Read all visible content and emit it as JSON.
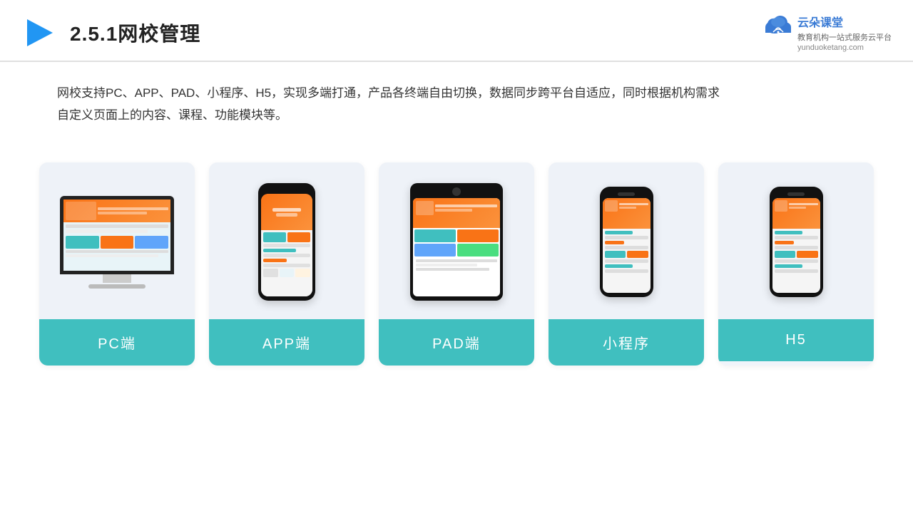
{
  "header": {
    "section_number": "2.5.1",
    "title": "网校管理",
    "brand_name": "云朵课堂",
    "brand_url": "yunduoketang.com",
    "brand_tagline": "教育机构一站式服务云平台"
  },
  "description": {
    "text": "网校支持PC、APP、PAD、小程序、H5，实现多端打通，产品各终端自由切换，数据同步跨平台自适应，同时根据机构需求自定义页面上的内容、课程、功能模块等。"
  },
  "cards": [
    {
      "id": "pc",
      "label": "PC端"
    },
    {
      "id": "app",
      "label": "APP端"
    },
    {
      "id": "pad",
      "label": "PAD端"
    },
    {
      "id": "miniprogram",
      "label": "小程序"
    },
    {
      "id": "h5",
      "label": "H5"
    }
  ],
  "colors": {
    "teal": "#40bfbf",
    "accent_blue": "#3a7bd5",
    "arrow_blue": "#2196f3",
    "bg_card": "#eef2f7"
  }
}
